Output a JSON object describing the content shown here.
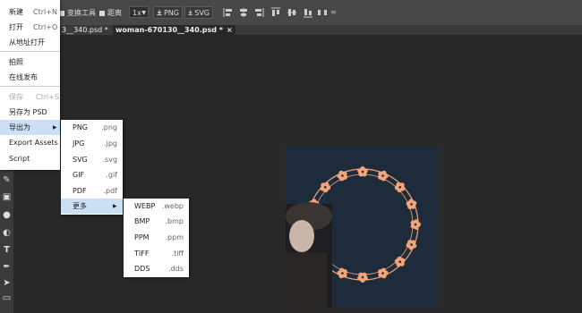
{
  "topbar": {
    "transform_controls": "变换工具",
    "distances": "距离",
    "zoom": "1x",
    "download_png": "PNG",
    "download_svg": "SVG"
  },
  "tabs": [
    {
      "label": "3__340.psd *",
      "close": "×"
    },
    {
      "label": "woman-670130__340.psd *",
      "close": "×"
    }
  ],
  "file_menu": {
    "items": [
      {
        "label": "新建",
        "shortcut": "Ctrl+N"
      },
      {
        "label": "打开",
        "shortcut": "Ctrl+O"
      },
      {
        "label": "从地址打开",
        "shortcut": ""
      },
      {
        "label": "拍照",
        "shortcut": ""
      },
      {
        "label": "在线发布",
        "shortcut": ""
      },
      {
        "label": "保存",
        "shortcut": "Ctrl+S"
      },
      {
        "label": "另存为 PSD",
        "shortcut": ""
      },
      {
        "label": "导出为",
        "shortcut": ""
      },
      {
        "label": "Export Assets",
        "shortcut": ""
      },
      {
        "label": "Script",
        "shortcut": ""
      }
    ]
  },
  "export_menu": {
    "items": [
      {
        "label": "PNG",
        "ext": ".png"
      },
      {
        "label": "JPG",
        "ext": ".jpg"
      },
      {
        "label": "SVG",
        "ext": ".svg"
      },
      {
        "label": "GIF",
        "ext": ".gif"
      },
      {
        "label": "PDF",
        "ext": ".pdf"
      },
      {
        "label": "更多",
        "ext": ""
      }
    ]
  },
  "more_menu": {
    "items": [
      {
        "label": "WEBP",
        "ext": ".webp"
      },
      {
        "label": "BMP",
        "ext": ".bmp"
      },
      {
        "label": "PPM",
        "ext": ".ppm"
      },
      {
        "label": "TIFF",
        "ext": ".tiff"
      },
      {
        "label": "DDS",
        "ext": ".dds"
      }
    ]
  },
  "colors": {
    "app_bg": "#282828",
    "topbar": "#474747",
    "menu_bg": "#ffffff",
    "menu_highlight": "#cce0f5",
    "canvas_bg": "#1e2b3a",
    "flower": "#f2a57a"
  },
  "icons": [
    "arrow-right-icon",
    "download-icon",
    "align-left-icon",
    "align-center-icon",
    "align-right-icon",
    "align-top-icon",
    "align-middle-icon",
    "align-bottom-icon",
    "distribute-icon",
    "transform-3d-icon"
  ]
}
